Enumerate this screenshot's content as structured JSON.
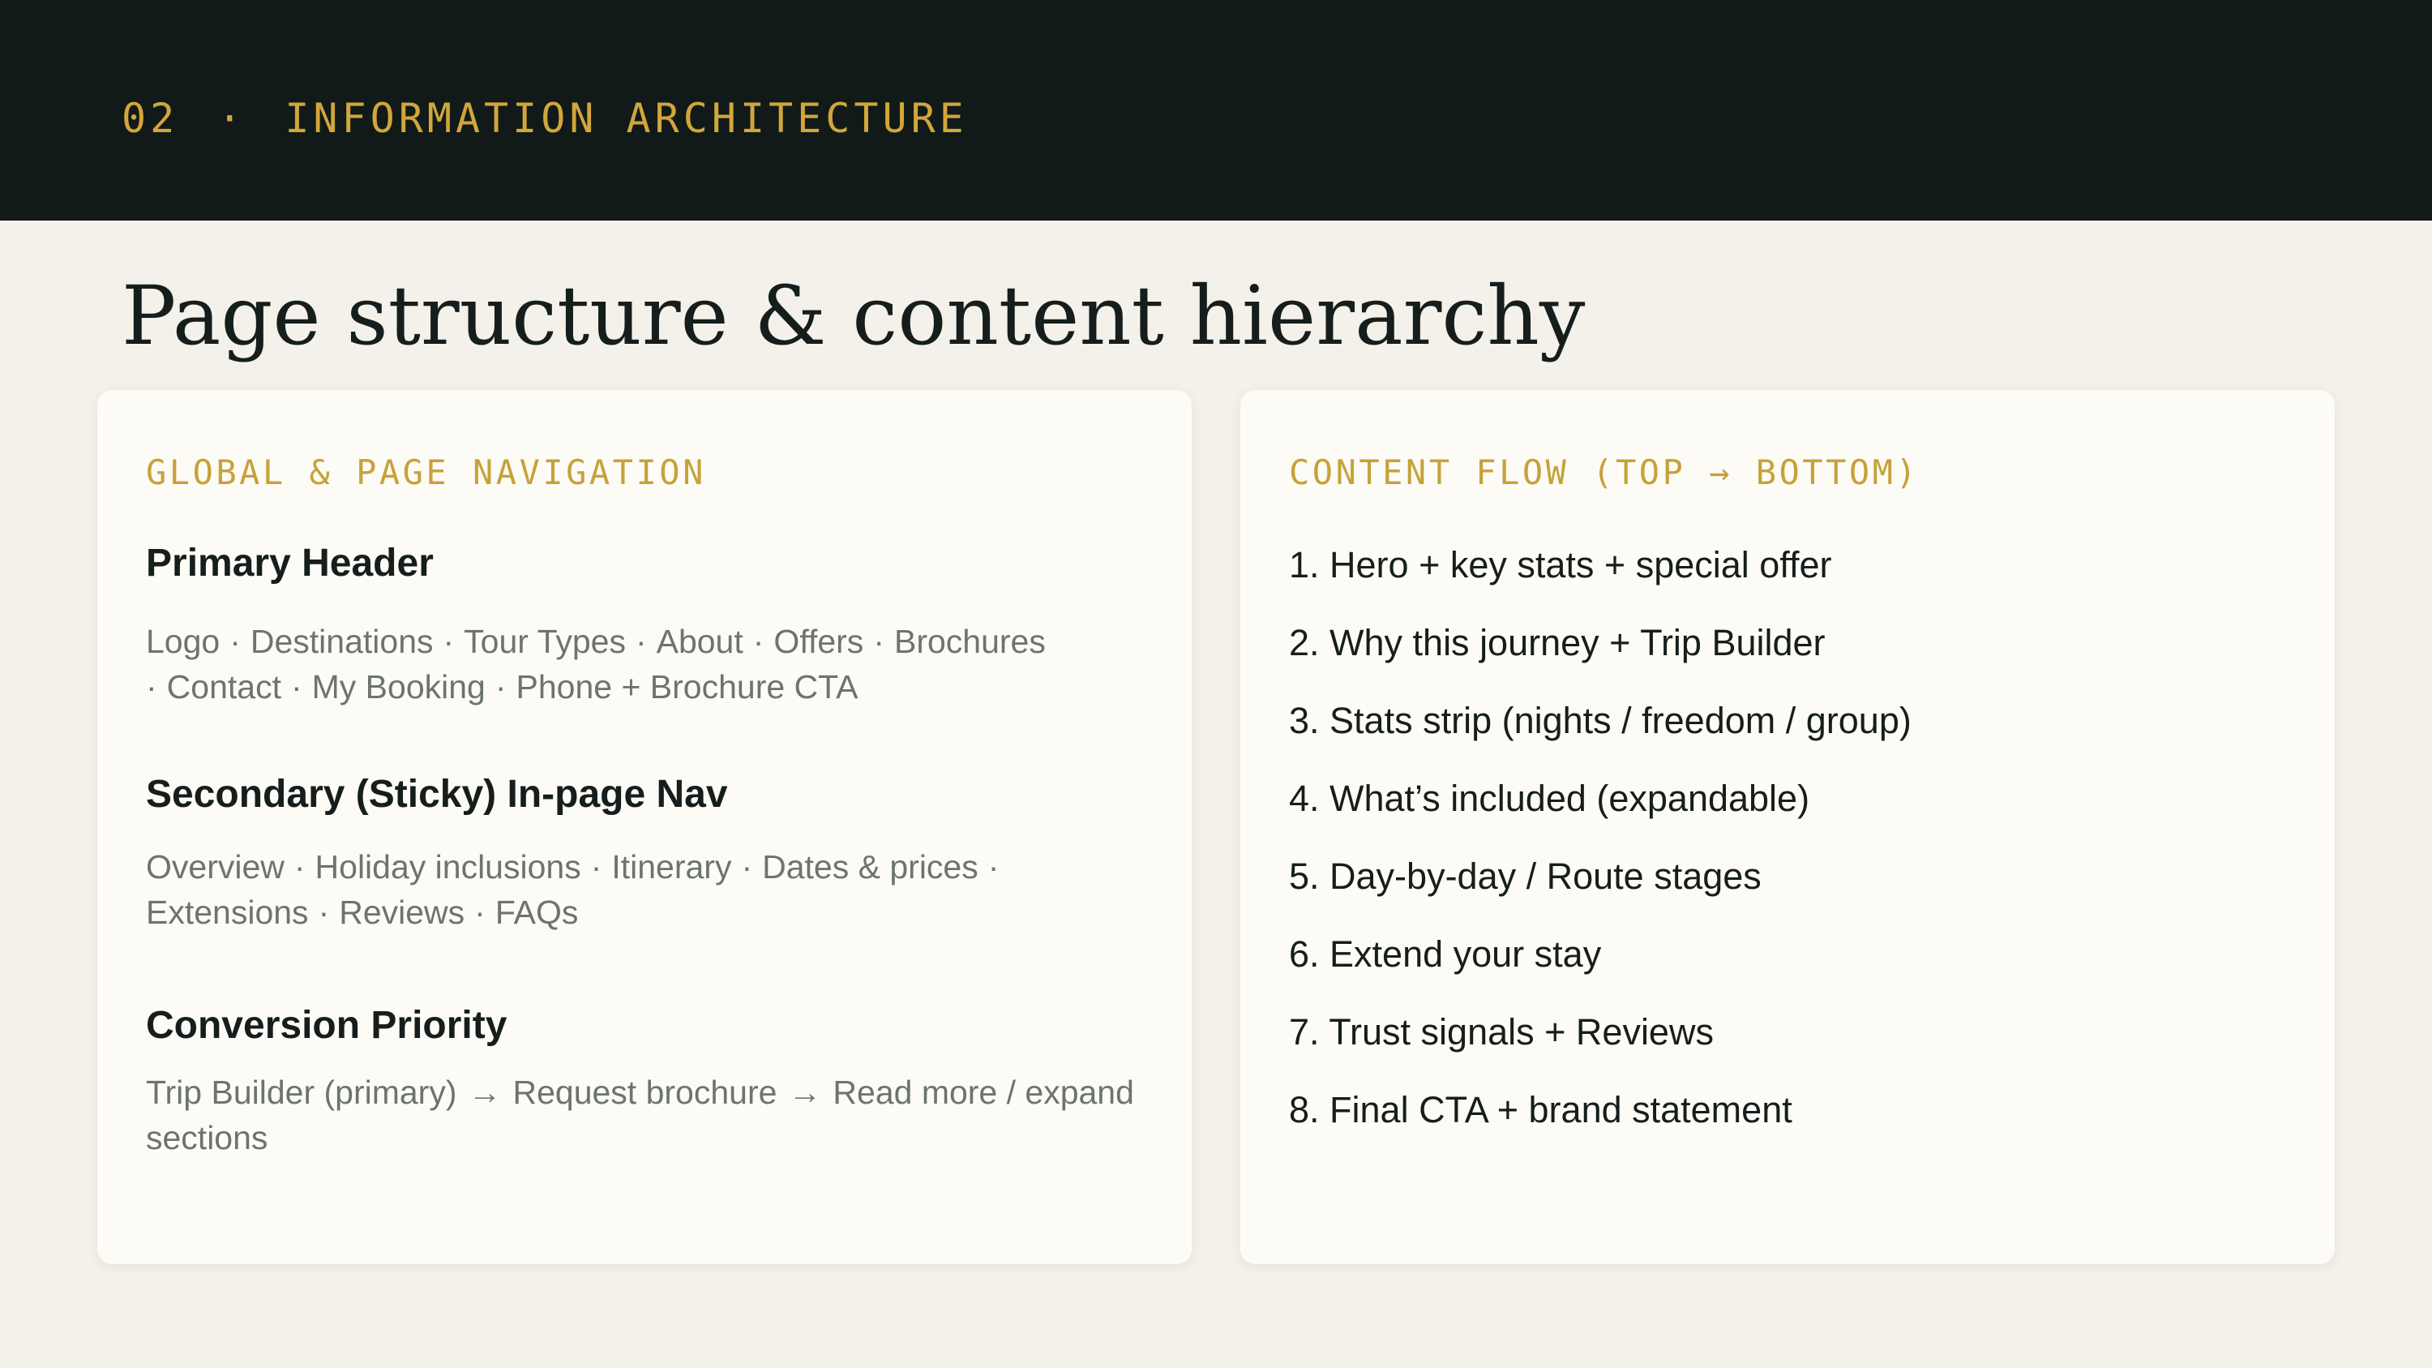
{
  "header": {
    "number": "02",
    "separator": "·",
    "section": "INFORMATION ARCHITECTURE"
  },
  "title": "Page structure & content hierarchy",
  "left_card": {
    "heading": "GLOBAL & PAGE NAVIGATION",
    "primary_header": {
      "title": "Primary Header",
      "items": [
        "Logo",
        "Destinations",
        "Tour Types",
        "About",
        "Offers",
        "Brochures",
        "Contact",
        "My Booking",
        "Phone + Brochure CTA"
      ]
    },
    "secondary_nav": {
      "title": "Secondary (Sticky) In-page Nav",
      "items": [
        "Overview",
        "Holiday inclusions",
        "Itinerary",
        "Dates & prices",
        "Extensions",
        "Reviews",
        "FAQs"
      ]
    },
    "conversion": {
      "title": "Conversion Priority",
      "steps": [
        "Trip Builder (primary)",
        "Request brochure",
        "Read more / expand sections"
      ],
      "arrow": "→"
    },
    "dot": "·"
  },
  "right_card": {
    "heading": "CONTENT FLOW (TOP → BOTTOM)",
    "items": [
      "1. Hero + key stats + special offer",
      "2. Why this journey + Trip Builder",
      "3. Stats strip (nights / freedom / group)",
      "4. What’s included (expandable)",
      "5. Day-by-day / Route stages",
      "6. Extend your stay",
      "7. Trust signals + Reviews",
      "8. Final CTA + brand statement"
    ]
  }
}
